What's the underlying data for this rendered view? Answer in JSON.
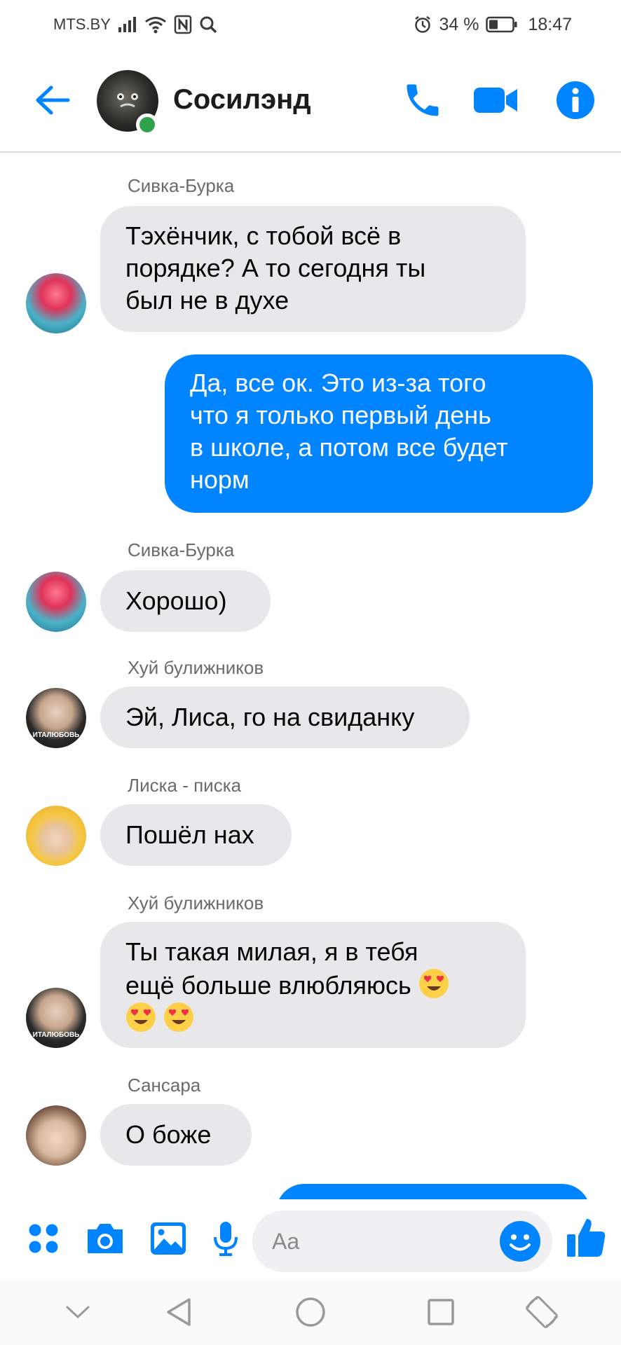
{
  "status_bar": {
    "carrier": "MTS.BY",
    "battery_percent": "34 %",
    "time": "18:47",
    "icons": [
      "signal-icon",
      "wifi-icon",
      "nfc-icon",
      "search-icon",
      "alarm-icon",
      "battery-icon"
    ]
  },
  "header": {
    "title": "Сосилэнд",
    "online": true,
    "icons": [
      "back-arrow-icon",
      "phone-icon",
      "video-camera-icon",
      "info-icon"
    ]
  },
  "messages": [
    {
      "sender": "Сивка-Бурка",
      "direction": "in",
      "lines": [
        "Тэхёнчик, с тобой всё в",
        "порядке? А то сегодня ты",
        "был не в духе"
      ]
    },
    {
      "direction": "out",
      "lines": [
        "Да, все ок. Это из-за того",
        "что я только первый день",
        "в школе, а потом все будет",
        "норм"
      ]
    },
    {
      "sender": "Сивка-Бурка",
      "direction": "in",
      "lines": [
        "Хорошо)"
      ]
    },
    {
      "sender": "Хуй булижников",
      "direction": "in",
      "lines": [
        "Эй, Лиса, го на свиданку"
      ]
    },
    {
      "sender": "Лиска - писка",
      "direction": "in",
      "lines": [
        "Пошёл нах"
      ]
    },
    {
      "sender": "Хуй булижников",
      "direction": "in",
      "lines": [
        "Ты такая милая, я в тебя",
        "ещё больше влюбляюсь"
      ],
      "emoji": "heart-eyes"
    },
    {
      "sender": "Сансара",
      "direction": "in",
      "lines": [
        "О боже"
      ]
    }
  ],
  "avatar_caption": "ИТАЛЮБОВЬ",
  "composer": {
    "placeholder": "Aa",
    "icons": [
      "apps-icon",
      "camera-icon",
      "gallery-icon",
      "microphone-icon",
      "emoji-icon",
      "thumbs-up-icon"
    ]
  },
  "navbar": {
    "icons": [
      "chevron-down-icon",
      "back-triangle-icon",
      "home-circle-icon",
      "recents-square-icon",
      "rotate-icon"
    ]
  },
  "colors": {
    "accent": "#0084ff",
    "incoming_bubble": "#e8e8eb",
    "online": "#31a24c"
  }
}
